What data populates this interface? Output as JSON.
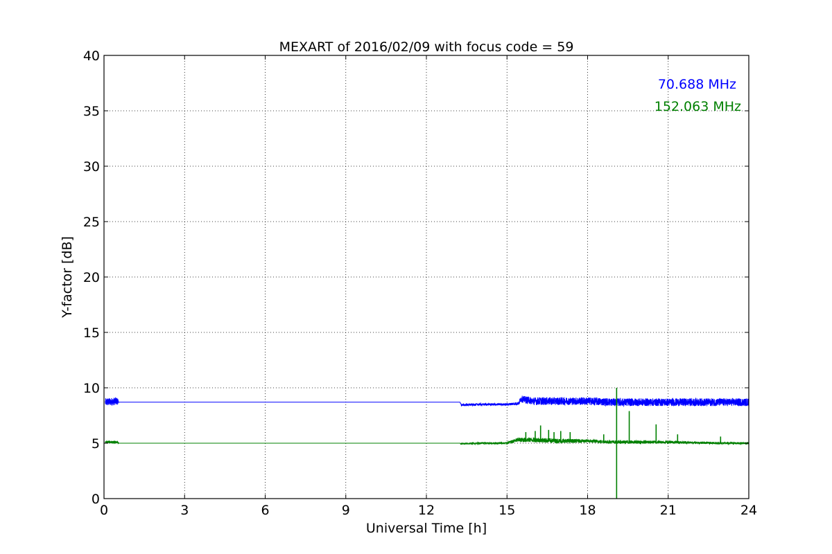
{
  "chart_data": {
    "type": "line",
    "title": "MEXART of 2016/02/09 with focus code = 59",
    "xlabel": "Universal Time [h]",
    "ylabel": "Y-factor [dB]",
    "xlim": [
      0,
      24
    ],
    "ylim": [
      0,
      40
    ],
    "xticks": [
      0,
      3,
      6,
      9,
      12,
      15,
      18,
      21,
      24
    ],
    "yticks": [
      0,
      5,
      10,
      15,
      20,
      25,
      30,
      35,
      40
    ],
    "grid": true,
    "legend_placement": "top-right",
    "series": [
      {
        "name": "70.688 MHz",
        "color": "#0000ff",
        "x": [
          0.05,
          0.5,
          0.55,
          13.25,
          13.3,
          14.0,
          15.0,
          15.45,
          15.5,
          16.0,
          17.0,
          18.0,
          19.0,
          20.0,
          21.0,
          22.0,
          23.0,
          24.0
        ],
        "y": [
          8.7,
          8.8,
          8.7,
          8.7,
          8.45,
          8.5,
          8.5,
          8.6,
          9.0,
          8.8,
          8.8,
          8.8,
          8.7,
          8.7,
          8.7,
          8.7,
          8.7,
          8.7
        ],
        "noise": [
          0.35,
          0.35,
          0,
          0,
          0.1,
          0.1,
          0.1,
          0.15,
          0.3,
          0.35,
          0.35,
          0.35,
          0.35,
          0.35,
          0.35,
          0.35,
          0.35,
          0.35
        ]
      },
      {
        "name": "152.063 MHz",
        "color": "#008000",
        "x": [
          0.05,
          0.5,
          0.55,
          13.25,
          13.3,
          14.0,
          15.0,
          15.4,
          16.0,
          17.0,
          18.0,
          19.0,
          20.0,
          21.0,
          22.0,
          23.0,
          24.0
        ],
        "y": [
          5.1,
          5.1,
          5.0,
          5.0,
          4.95,
          5.0,
          5.0,
          5.3,
          5.3,
          5.2,
          5.2,
          5.1,
          5.1,
          5.1,
          5.05,
          5.0,
          5.0
        ],
        "noise": [
          0.12,
          0.12,
          0,
          0,
          0.08,
          0.08,
          0.1,
          0.2,
          0.22,
          0.2,
          0.15,
          0.15,
          0.15,
          0.12,
          0.1,
          0.1,
          0.1
        ],
        "spikes": [
          {
            "x": 15.7,
            "y": 6.0
          },
          {
            "x": 16.05,
            "y": 6.1
          },
          {
            "x": 16.25,
            "y": 6.6
          },
          {
            "x": 16.55,
            "y": 6.2
          },
          {
            "x": 16.75,
            "y": 6.0
          },
          {
            "x": 17.0,
            "y": 6.1
          },
          {
            "x": 17.35,
            "y": 6.0
          },
          {
            "x": 18.6,
            "y": 5.8
          },
          {
            "x": 19.08,
            "y": 10.0
          },
          {
            "x": 19.08,
            "y": 0.0
          },
          {
            "x": 19.55,
            "y": 7.9
          },
          {
            "x": 20.55,
            "y": 6.7
          },
          {
            "x": 21.35,
            "y": 5.8
          },
          {
            "x": 22.95,
            "y": 5.6
          }
        ]
      }
    ]
  }
}
